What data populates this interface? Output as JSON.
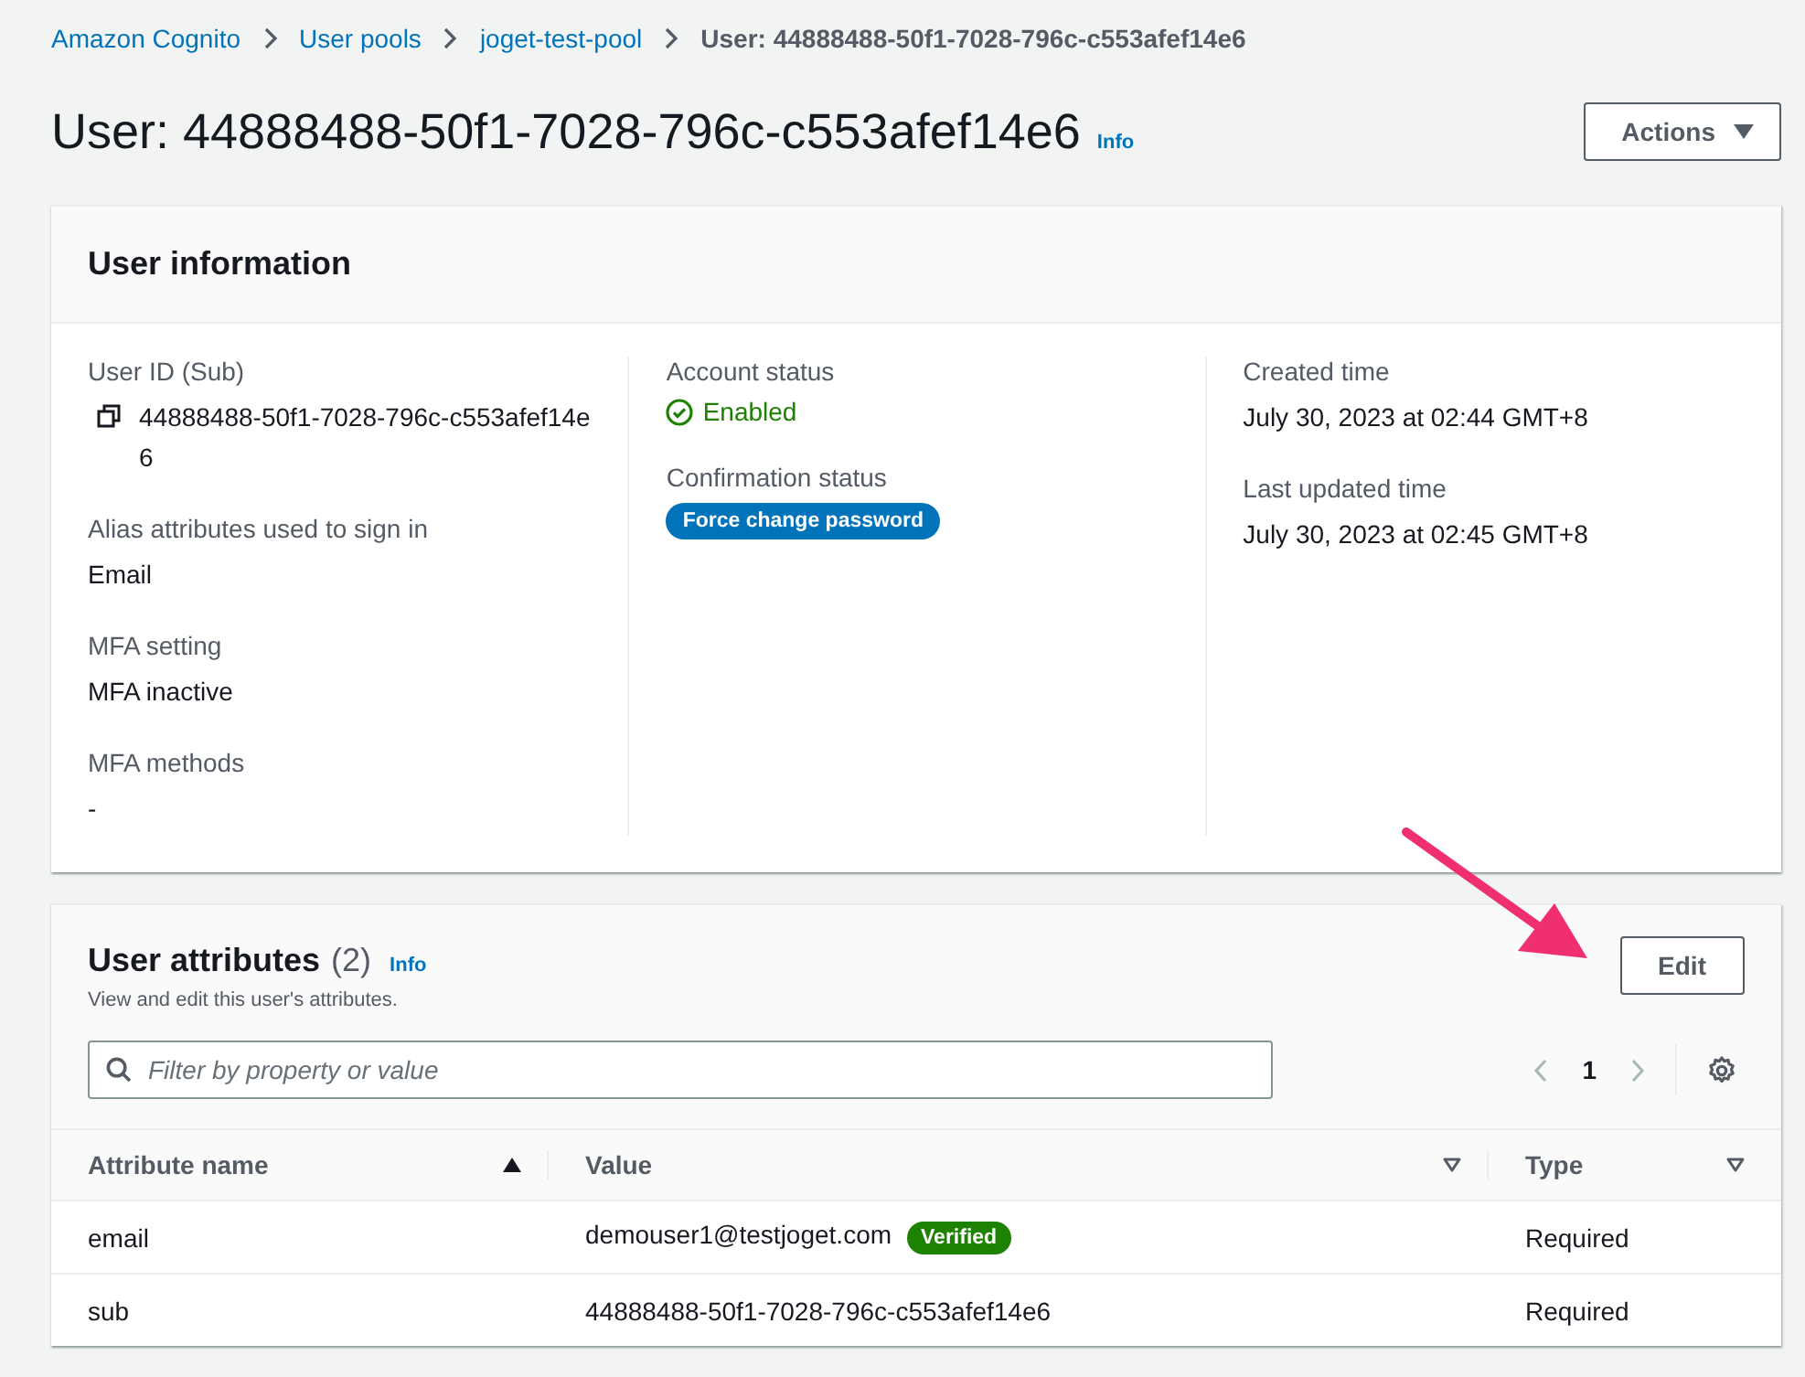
{
  "breadcrumbs": [
    {
      "label": "Amazon Cognito",
      "link": true
    },
    {
      "label": "User pools",
      "link": true
    },
    {
      "label": "joget-test-pool",
      "link": true
    },
    {
      "label": "User: 44888488-50f1-7028-796c-c553afef14e6",
      "link": false
    }
  ],
  "header": {
    "title": "User: 44888488-50f1-7028-796c-c553afef14e6",
    "info": "Info",
    "action": "Actions"
  },
  "user_information": {
    "title": "User information",
    "columns": [
      [
        {
          "label": "User ID (Sub)",
          "value": "44888488-50f1-7028-796c-c553afef14e6",
          "kind": "copy"
        },
        {
          "label": "Alias attributes used to sign in",
          "value": "Email",
          "kind": "text"
        },
        {
          "label": "MFA setting",
          "value": "MFA inactive",
          "kind": "text"
        },
        {
          "label": "MFA methods",
          "value": "-",
          "kind": "text"
        }
      ],
      [
        {
          "label": "Account status",
          "value": "Enabled",
          "kind": "status"
        },
        {
          "label": "Confirmation status",
          "value": "Force change password",
          "kind": "badge"
        }
      ],
      [
        {
          "label": "Created time",
          "value": "July 30, 2023 at 02:44 GMT+8",
          "kind": "text"
        },
        {
          "label": "Last updated time",
          "value": "July 30, 2023 at 02:45 GMT+8",
          "kind": "text"
        }
      ]
    ]
  },
  "user_attributes": {
    "title": "User attributes",
    "count": "(2)",
    "info": "Info",
    "description": "View and edit this user's attributes.",
    "action": "Edit",
    "filter": {
      "placeholder": "Filter by property or value"
    },
    "pagination": {
      "page": "1",
      "prev_disabled": true,
      "next_disabled": true
    },
    "columns": [
      {
        "label": "Attribute name",
        "sorted": true
      },
      {
        "label": "Value",
        "sorted": false
      },
      {
        "label": "Type",
        "sorted": false
      }
    ],
    "rows": [
      {
        "name": "email",
        "value": "demouser1@testjoget.com",
        "badge": "Verified",
        "type": "Required"
      },
      {
        "name": "sub",
        "value": "44888488-50f1-7028-796c-c553afef14e6",
        "type": "Required"
      }
    ]
  }
}
